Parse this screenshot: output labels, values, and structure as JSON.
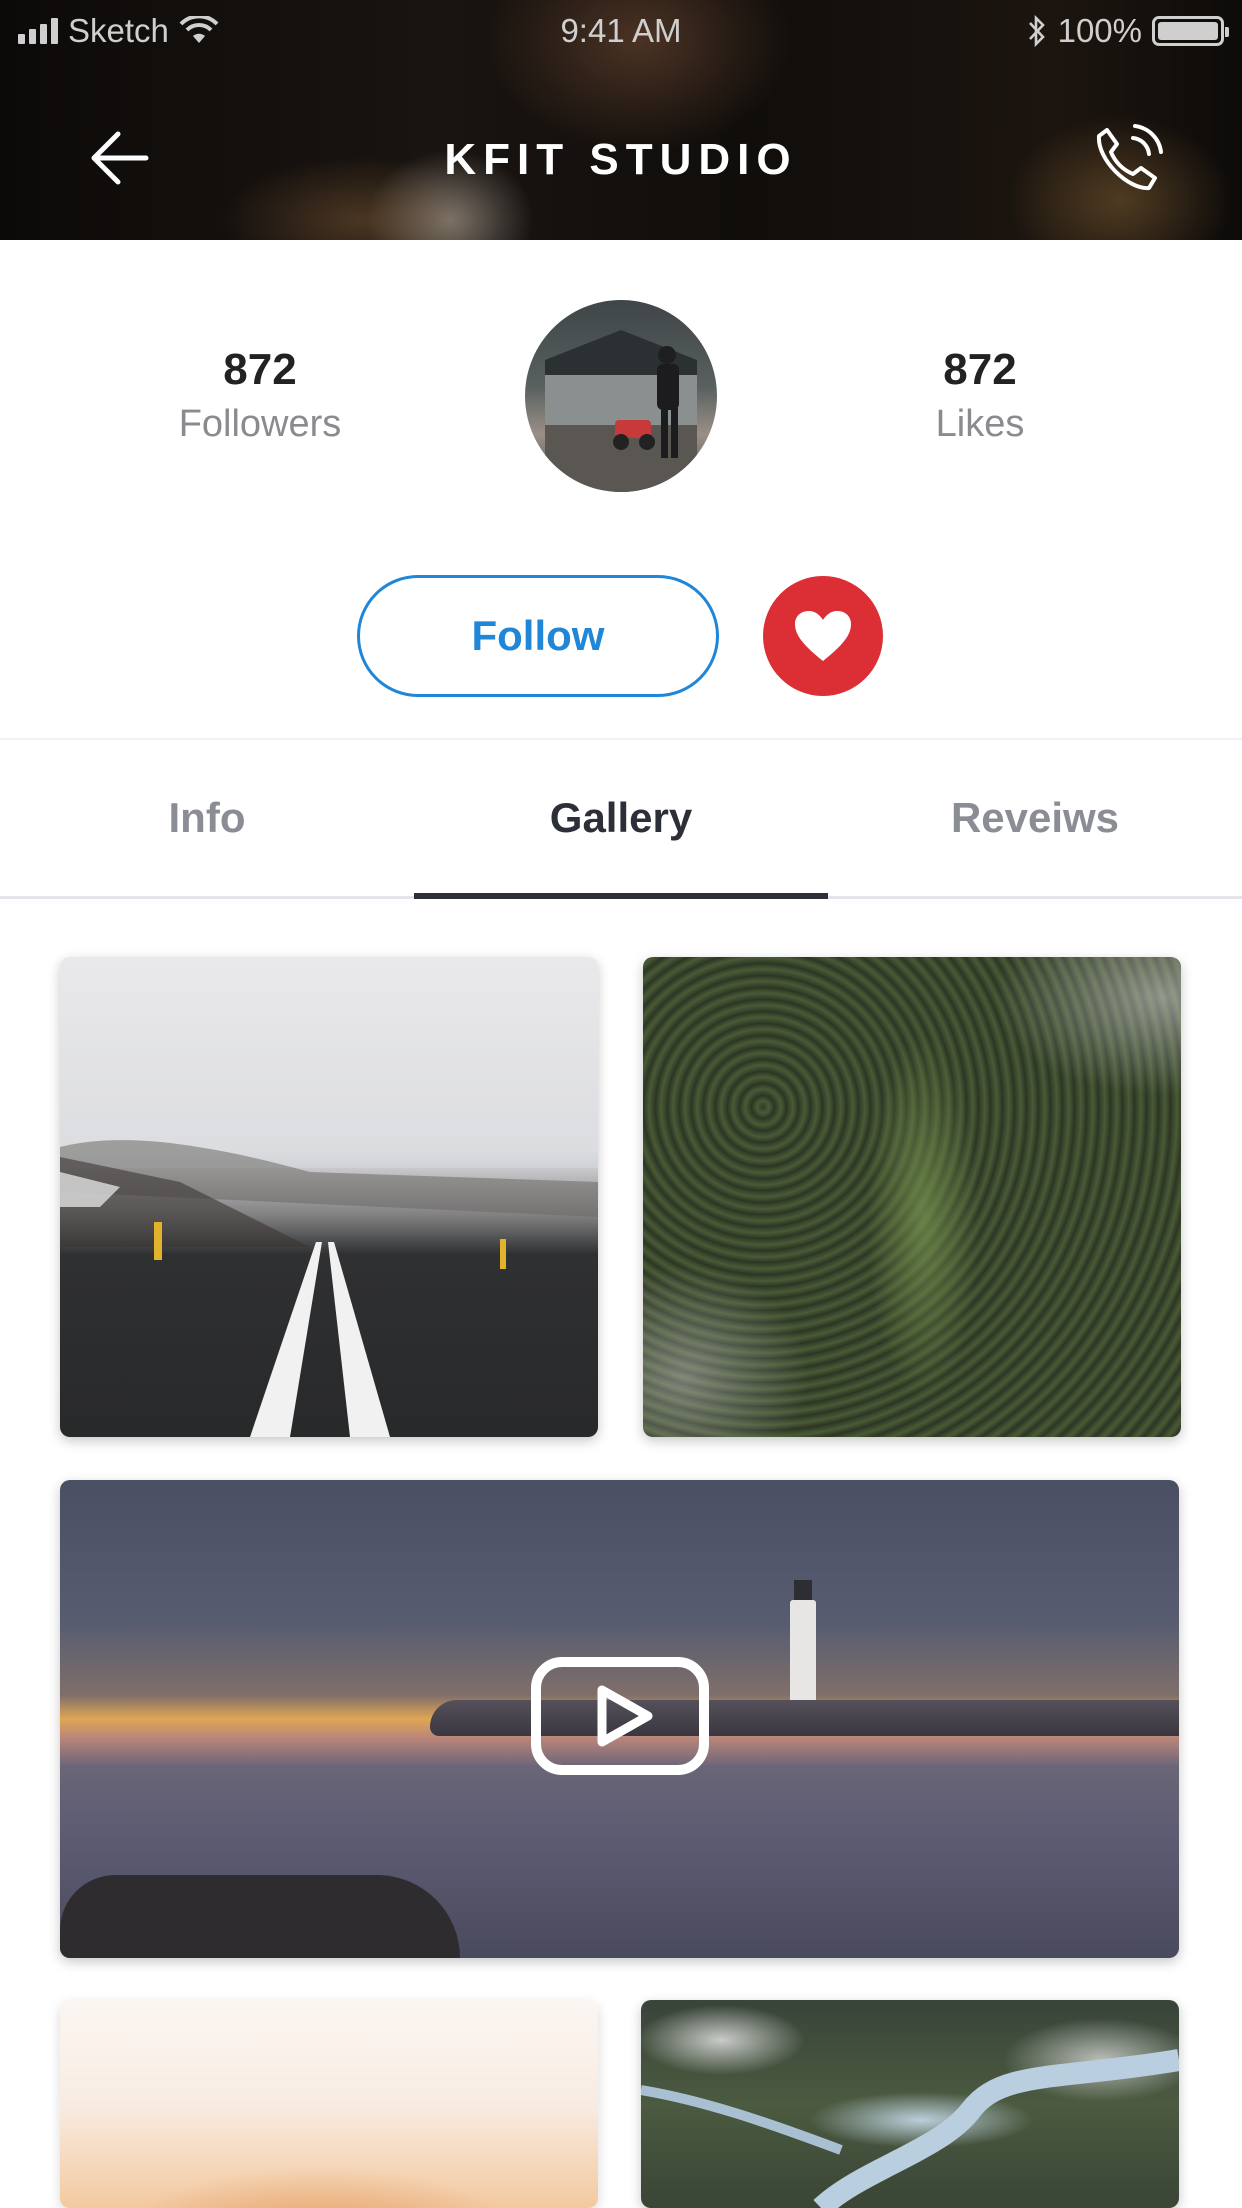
{
  "status_bar": {
    "carrier": "Sketch",
    "time": "9:41 AM",
    "battery": "100%"
  },
  "header": {
    "title": "KFIT STUDIO",
    "back_icon": "arrow-left-icon",
    "call_icon": "phone-icon"
  },
  "profile": {
    "followers_count": "872",
    "followers_label": "Followers",
    "likes_count": "872",
    "likes_label": "Likes"
  },
  "actions": {
    "follow_label": "Follow",
    "like_icon": "heart-icon"
  },
  "tabs": [
    {
      "label": "Info",
      "active": false
    },
    {
      "label": "Gallery",
      "active": true
    },
    {
      "label": "Reveiws",
      "active": false
    }
  ],
  "gallery": [
    {
      "type": "photo",
      "subject": "snowy road"
    },
    {
      "type": "photo",
      "subject": "forest aerial"
    },
    {
      "type": "video",
      "subject": "lighthouse at sunset"
    },
    {
      "type": "photo",
      "subject": "desert dunes"
    },
    {
      "type": "photo",
      "subject": "river aerial"
    }
  ],
  "colors": {
    "accent_blue": "#1f86d8",
    "like_red": "#dc2f35",
    "tab_active": "#2c2f38",
    "tab_inactive": "#8a8d93"
  }
}
